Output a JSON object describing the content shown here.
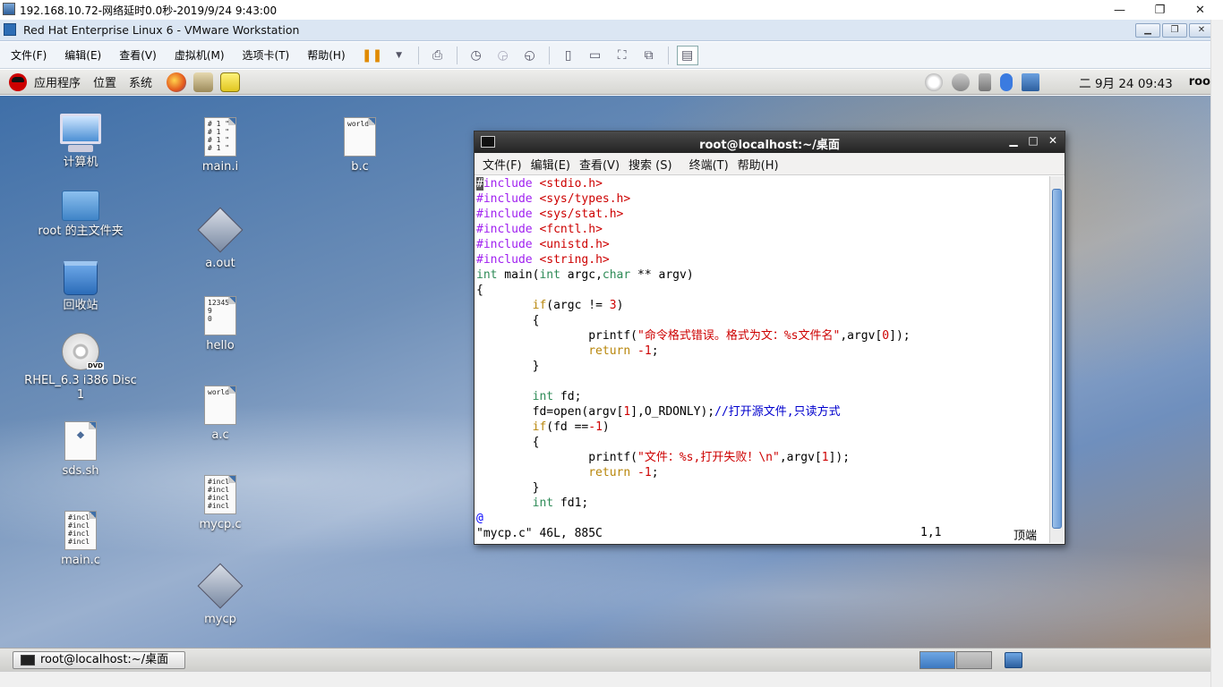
{
  "rdp": {
    "title": "192.168.10.72-网络延时0.0秒-2019/9/24 9:43:00",
    "minimize": "—",
    "restore": "❐",
    "close": "✕"
  },
  "vmware": {
    "title": "Red Hat Enterprise Linux 6 - VMware Workstation",
    "menu": [
      "文件(F)",
      "编辑(E)",
      "查看(V)",
      "虚拟机(M)",
      "选项卡(T)",
      "帮助(H)"
    ]
  },
  "gnome": {
    "menu": {
      "apps": "应用程序",
      "places": "位置",
      "system": "系统"
    },
    "clock": "二 9月 24 09:43",
    "user": "roo"
  },
  "desktop": {
    "icons": {
      "computer": "计算机",
      "home": "root 的主文件夹",
      "trash": "回收站",
      "dvd": "RHEL_6.3 i386 Disc 1",
      "sds": "sds.sh",
      "mainc": "main.c",
      "maini": "main.i",
      "aout": "a.out",
      "hello": "hello",
      "ac": "a.c",
      "mycpc": "mycp.c",
      "mycp": "mycp",
      "bc": "b.c"
    },
    "thumbs": {
      "maini": "# 1 \"\n# 1 \"\n# 1 \"\n# 1 \"",
      "hello": "12345\n9\n0",
      "ac": "world",
      "bc": "world",
      "code": "#incl\n#incl\n#incl\n#incl"
    }
  },
  "terminal": {
    "title": "root@localhost:~/桌面",
    "menu": [
      "文件(F)",
      "编辑(E)",
      "查看(V)",
      "搜索 (S)",
      "终端(T)",
      "帮助(H)"
    ],
    "status_file": "\"mycp.c\" 46L, 885C",
    "status_pos": "1,1",
    "status_top": "顶端"
  },
  "taskbar": {
    "window": "root@localhost:~/桌面"
  }
}
